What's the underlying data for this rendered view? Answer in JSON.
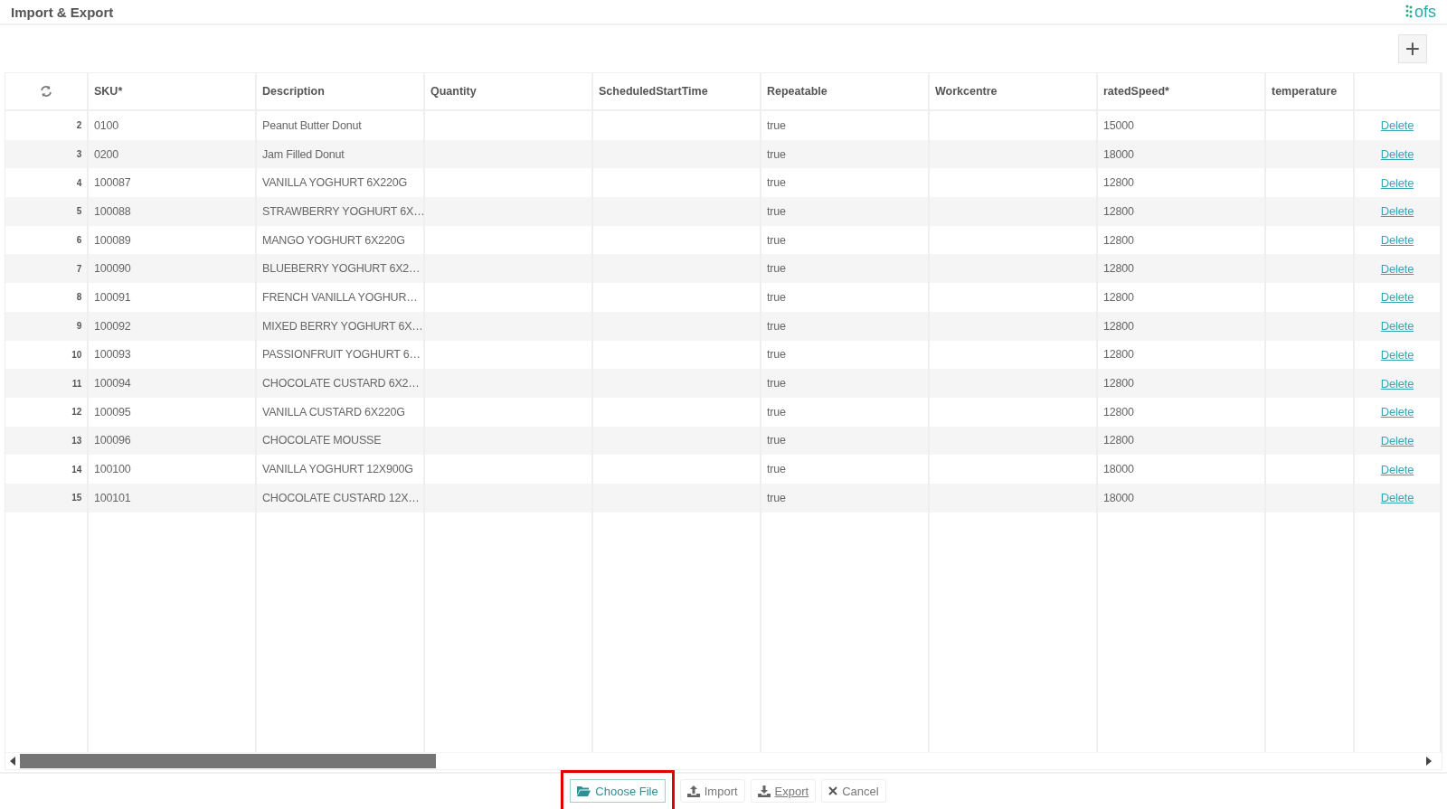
{
  "header": {
    "title": "Import & Export",
    "logo_text": "ofs"
  },
  "toolbar": {
    "add_button": "+"
  },
  "table": {
    "columns": [
      "SKU*",
      "Description",
      "Quantity",
      "ScheduledStartTime",
      "Repeatable",
      "Workcentre",
      "ratedSpeed*",
      "temperature"
    ],
    "rows": [
      {
        "index": "2",
        "sku": "0100",
        "description": "Peanut Butter Donut",
        "repeatable": "true",
        "rated_speed": "15000",
        "action": "Delete"
      },
      {
        "index": "3",
        "sku": "0200",
        "description": "Jam Filled Donut",
        "repeatable": "true",
        "rated_speed": "18000",
        "action": "Delete"
      },
      {
        "index": "4",
        "sku": "100087",
        "description": "VANILLA YOGHURT 6X220G",
        "repeatable": "true",
        "rated_speed": "12800",
        "action": "Delete"
      },
      {
        "index": "5",
        "sku": "100088",
        "description": "STRAWBERRY YOGHURT 6X…",
        "repeatable": "true",
        "rated_speed": "12800",
        "action": "Delete"
      },
      {
        "index": "6",
        "sku": "100089",
        "description": "MANGO YOGHURT 6X220G",
        "repeatable": "true",
        "rated_speed": "12800",
        "action": "Delete"
      },
      {
        "index": "7",
        "sku": "100090",
        "description": "BLUEBERRY YOGHURT 6X2…",
        "repeatable": "true",
        "rated_speed": "12800",
        "action": "Delete"
      },
      {
        "index": "8",
        "sku": "100091",
        "description": "FRENCH VANILLA YOGHUR…",
        "repeatable": "true",
        "rated_speed": "12800",
        "action": "Delete"
      },
      {
        "index": "9",
        "sku": "100092",
        "description": "MIXED BERRY YOGHURT 6X…",
        "repeatable": "true",
        "rated_speed": "12800",
        "action": "Delete"
      },
      {
        "index": "10",
        "sku": "100093",
        "description": "PASSIONFRUIT YOGHURT 6…",
        "repeatable": "true",
        "rated_speed": "12800",
        "action": "Delete"
      },
      {
        "index": "11",
        "sku": "100094",
        "description": "CHOCOLATE CUSTARD 6X2…",
        "repeatable": "true",
        "rated_speed": "12800",
        "action": "Delete"
      },
      {
        "index": "12",
        "sku": "100095",
        "description": "VANILLA CUSTARD 6X220G",
        "repeatable": "true",
        "rated_speed": "12800",
        "action": "Delete"
      },
      {
        "index": "13",
        "sku": "100096",
        "description": "CHOCOLATE MOUSSE",
        "repeatable": "true",
        "rated_speed": "12800",
        "action": "Delete"
      },
      {
        "index": "14",
        "sku": "100100",
        "description": "VANILLA YOGHURT 12X900G",
        "repeatable": "true",
        "rated_speed": "18000",
        "action": "Delete"
      },
      {
        "index": "15",
        "sku": "100101",
        "description": "CHOCOLATE CUSTARD 12X…",
        "repeatable": "true",
        "rated_speed": "18000",
        "action": "Delete"
      }
    ]
  },
  "footer": {
    "buttons": [
      {
        "kind": "choose",
        "label": "Choose File",
        "highlighted": true
      },
      {
        "kind": "import",
        "label": "Import",
        "highlighted": false
      },
      {
        "kind": "export",
        "label": "Export",
        "highlighted": false
      },
      {
        "kind": "cancel",
        "label": "Cancel",
        "highlighted": false
      }
    ]
  }
}
